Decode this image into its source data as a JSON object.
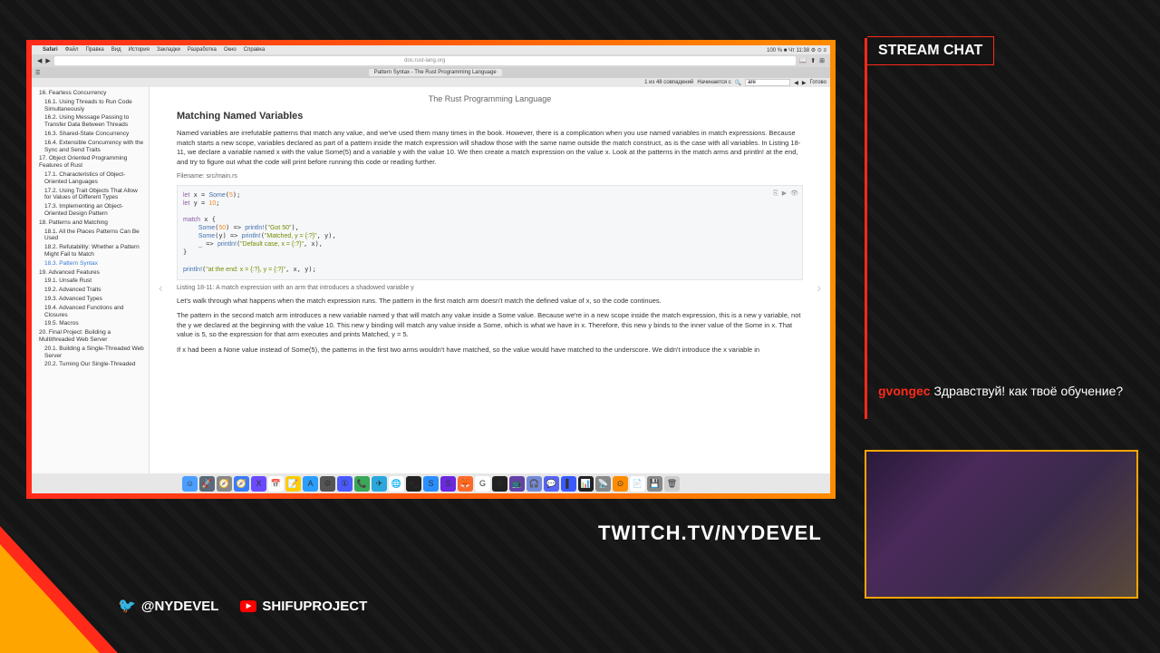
{
  "menubar": {
    "apple": "",
    "app": "Safari",
    "items": [
      "Файл",
      "Правка",
      "Вид",
      "История",
      "Закладки",
      "Разработка",
      "Окно",
      "Справка"
    ],
    "status": "100 % ■ Чт 11:38 ⚙ ⊙ ≡"
  },
  "toolbar": {
    "url": "doc.rust-lang.org"
  },
  "tab": {
    "title": "Pattern Syntax - The Rust Programming Language"
  },
  "findbar": {
    "count": "1 из 48 совпадений",
    "label": "Начинается с",
    "query": "are",
    "done": "Готово"
  },
  "doc": {
    "header": "The Rust Programming Language",
    "title": "Matching Named Variables",
    "p1": "Named variables are irrefutable patterns that match any value, and we've used them many times in the book. However, there is a complication when you use named variables in match expressions. Because match starts a new scope, variables declared as part of a pattern inside the match expression will shadow those with the same name outside the match construct, as is the case with all variables. In Listing 18-11, we declare a variable named x with the value Some(5) and a variable y with the value 10. We then create a match expression on the value x. Look at the patterns in the match arms and println! at the end, and try to figure out what the code will print before running this code or reading further.",
    "filename": "Filename: src/main.rs",
    "caption": "Listing 18-11: A match expression with an arm that introduces a shadowed variable y",
    "p2": "Let's walk through what happens when the match expression runs. The pattern in the first match arm doesn't match the defined value of x, so the code continues.",
    "p3": "The pattern in the second match arm introduces a new variable named y that will match any value inside a Some value. Because we're in a new scope inside the match expression, this is a new y variable, not the y we declared at the beginning with the value 10. This new y binding will match any value inside a Some, which is what we have in x. Therefore, this new y binds to the inner value of the Some in x. That value is 5, so the expression for that arm executes and prints Matched, y = 5.",
    "p4": "If x had been a None value instead of Some(5), the patterns in the first two arms wouldn't have matched, so the value would have matched to the underscore. We didn't introduce the x variable in"
  },
  "sidebar": [
    {
      "t": "16. Fearless Concurrency",
      "s": false
    },
    {
      "t": "16.1. Using Threads to Run Code Simultaneously",
      "s": true
    },
    {
      "t": "16.2. Using Message Passing to Transfer Data Between Threads",
      "s": true
    },
    {
      "t": "16.3. Shared-State Concurrency",
      "s": true
    },
    {
      "t": "16.4. Extensible Concurrency with the Sync and Send Traits",
      "s": true
    },
    {
      "t": "17. Object Oriented Programming Features of Rust",
      "s": false
    },
    {
      "t": "17.1. Characteristics of Object-Oriented Languages",
      "s": true
    },
    {
      "t": "17.2. Using Trait Objects That Allow for Values of Different Types",
      "s": true
    },
    {
      "t": "17.3. Implementing an Object-Oriented Design Pattern",
      "s": true
    },
    {
      "t": "18. Patterns and Matching",
      "s": false
    },
    {
      "t": "18.1. All the Places Patterns Can Be Used",
      "s": true
    },
    {
      "t": "18.2. Refutability: Whether a Pattern Might Fail to Match",
      "s": true
    },
    {
      "t": "18.3. Pattern Syntax",
      "s": true,
      "a": true
    },
    {
      "t": "19. Advanced Features",
      "s": false
    },
    {
      "t": "19.1. Unsafe Rust",
      "s": true
    },
    {
      "t": "19.2. Advanced Traits",
      "s": true
    },
    {
      "t": "19.3. Advanced Types",
      "s": true
    },
    {
      "t": "19.4. Advanced Functions and Closures",
      "s": true
    },
    {
      "t": "19.5. Macros",
      "s": true
    },
    {
      "t": "20. Final Project: Building a Multithreaded Web Server",
      "s": false
    },
    {
      "t": "20.1. Building a Single-Threaded Web Server",
      "s": true
    },
    {
      "t": "20.2. Turning Our Single-Threaded",
      "s": true
    }
  ],
  "dock": [
    {
      "c": "#4a9eff",
      "t": "☺"
    },
    {
      "c": "#5a6a7a",
      "t": "🚀"
    },
    {
      "c": "#888",
      "t": "🧭"
    },
    {
      "c": "#3a7bff",
      "t": "🧭"
    },
    {
      "c": "#6a4aff",
      "t": "X"
    },
    {
      "c": "#fff",
      "t": "📅"
    },
    {
      "c": "#ffcc00",
      "t": "📝"
    },
    {
      "c": "#2a9eff",
      "t": "A"
    },
    {
      "c": "#555",
      "t": "⚙"
    },
    {
      "c": "#4a5aff",
      "t": "①"
    },
    {
      "c": "#3aa856",
      "t": "📞"
    },
    {
      "c": "#2aa8dd",
      "t": "✈"
    },
    {
      "c": "#fff",
      "t": "🌐"
    },
    {
      "c": "#222",
      "t": ">_"
    },
    {
      "c": "#2a8eff",
      "t": "S"
    },
    {
      "c": "#6a2add",
      "t": "S"
    },
    {
      "c": "#ff6a2a",
      "t": "🦊"
    },
    {
      "c": "#fff",
      "t": "G"
    },
    {
      "c": "#222",
      "t": "⊙"
    },
    {
      "c": "#6441a5",
      "t": "📺"
    },
    {
      "c": "#7289da",
      "t": "🎧"
    },
    {
      "c": "#5865f2",
      "t": "💬"
    },
    {
      "c": "#3a5aff",
      "t": "▌"
    },
    {
      "c": "#222",
      "t": "📊"
    },
    {
      "c": "#888",
      "t": "📡"
    },
    {
      "c": "#ff8c00",
      "t": "⊙"
    },
    {
      "c": "#fff",
      "t": "📄"
    },
    {
      "c": "#888",
      "t": "💾"
    },
    {
      "c": "#ccc",
      "t": "🗑"
    }
  ],
  "chat": {
    "header": "STREAM CHAT",
    "user": "gvongec",
    "msg": "Здравствуй! как твоё обучение?"
  },
  "overlay": {
    "twitch": "TWITCH.TV/NYDEVEL",
    "twitter": "@NYDEVEL",
    "youtube": "SHIFUPROJECT"
  }
}
